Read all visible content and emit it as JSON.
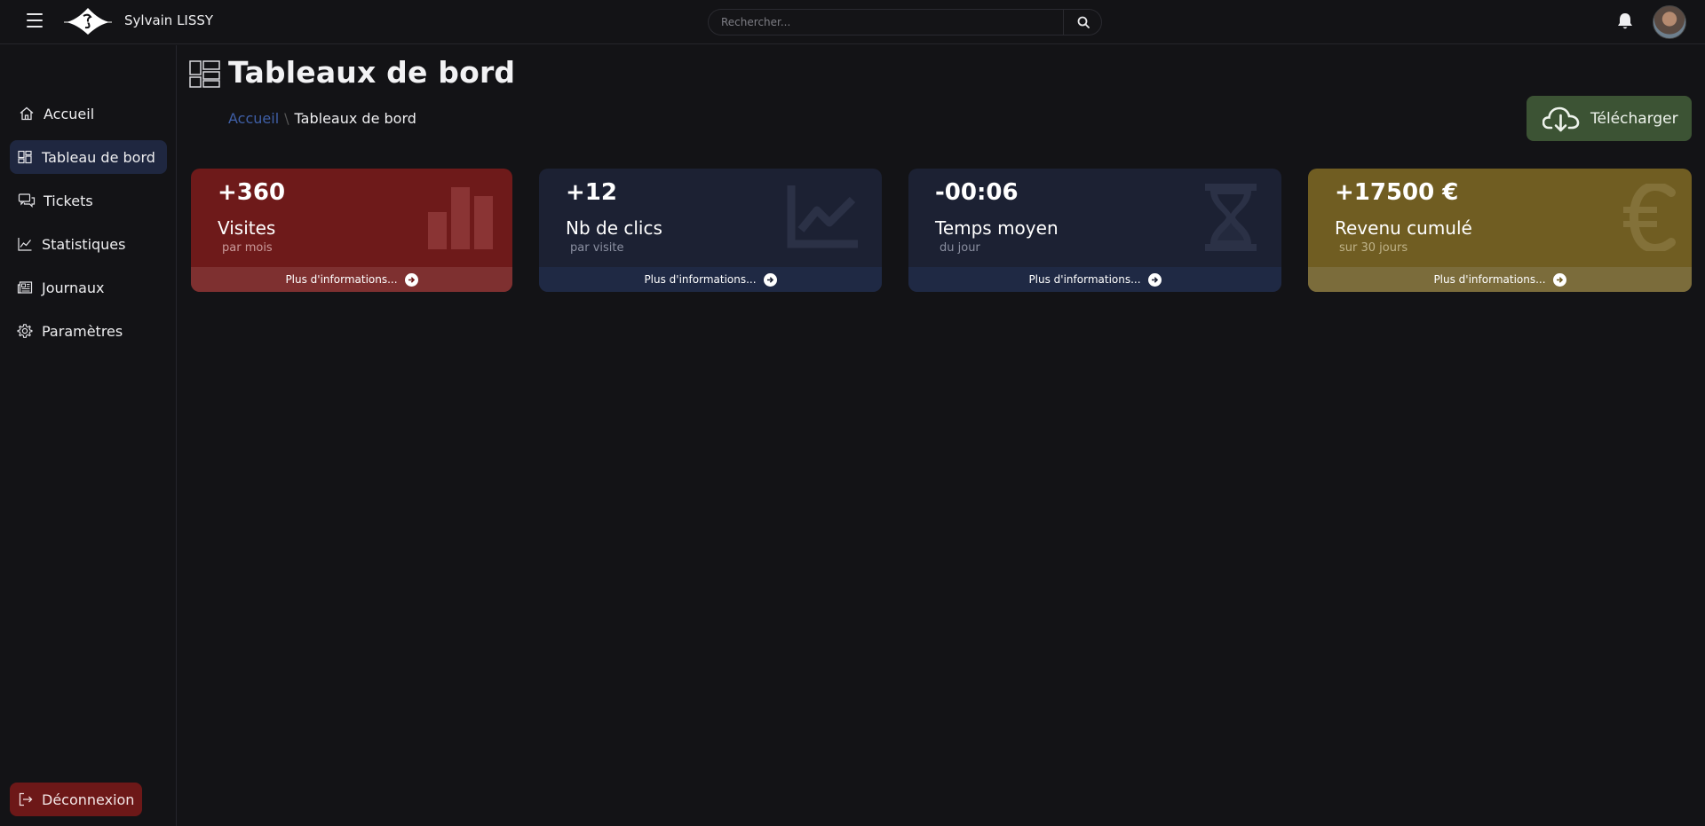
{
  "topbar": {
    "brand": "Sylvain LISSY",
    "search_placeholder": "Rechercher..."
  },
  "sidebar": {
    "items": [
      {
        "label": "Accueil",
        "icon": "home-icon"
      },
      {
        "label": "Tableau de bord",
        "icon": "dashboard-icon",
        "active": true
      },
      {
        "label": "Tickets",
        "icon": "chat-icon"
      },
      {
        "label": "Statistiques",
        "icon": "line-chart-icon"
      },
      {
        "label": "Journaux",
        "icon": "newspaper-icon"
      },
      {
        "label": "Paramètres",
        "icon": "gear-icon"
      }
    ],
    "logout_label": "Déconnexion"
  },
  "header": {
    "title": "Tableaux de bord",
    "breadcrumb": {
      "link": "Accueil",
      "separator": "\\",
      "current": "Tableaux de bord"
    },
    "download_label": "Télécharger"
  },
  "cards": [
    {
      "value": "+360",
      "label": "Visites",
      "sub": "par mois",
      "footer": "Plus d'informations...",
      "icon": "bar-chart-icon",
      "color": "#6e1a1a"
    },
    {
      "value": "+12",
      "label": "Nb de clics",
      "sub": "par visite",
      "footer": "Plus d'informations...",
      "icon": "trend-chart-icon",
      "color": "#1c2133"
    },
    {
      "value": "-00:06",
      "label": "Temps moyen",
      "sub": "du jour",
      "footer": "Plus d'informations...",
      "icon": "hourglass-icon",
      "color": "#1c2133"
    },
    {
      "value": "+17500 €",
      "label": "Revenu cumulé",
      "sub": "sur 30 jours",
      "footer": "Plus d'informations...",
      "icon": "euro-icon",
      "color": "#705d22"
    }
  ],
  "colors": {
    "background": "#131316",
    "active_nav": "#1f2740",
    "logout": "#6d1818",
    "download": "#3c5334",
    "link": "#3f5fa7"
  }
}
